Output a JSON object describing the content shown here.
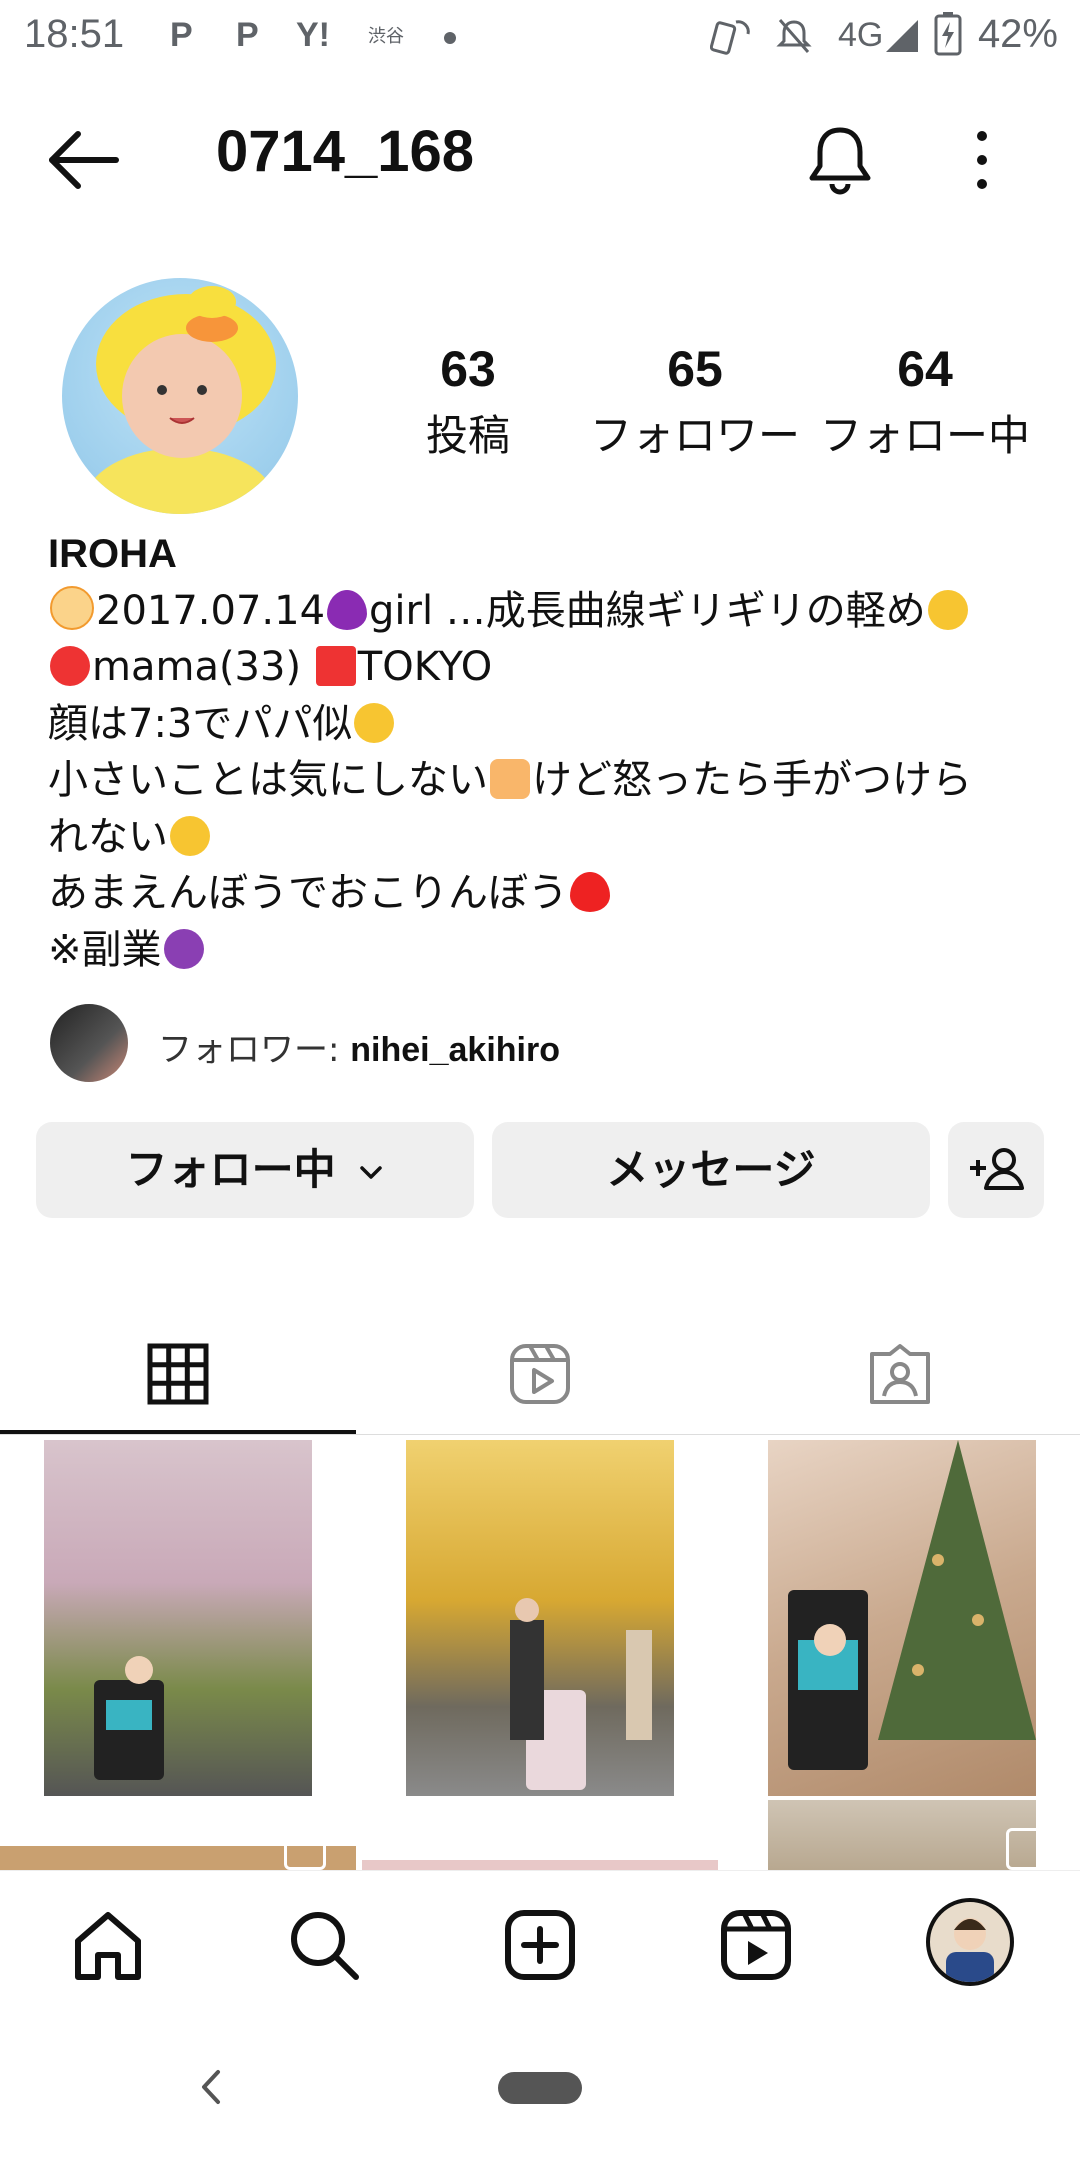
{
  "status_bar": {
    "time": "18:51",
    "notif_icons": [
      "P",
      "P",
      "Y!",
      "渋谷"
    ],
    "network": "4G",
    "battery": "42%"
  },
  "header": {
    "username": "0714_168"
  },
  "stats": [
    {
      "value": "63",
      "label": "投稿"
    },
    {
      "value": "65",
      "label": "フォロワー"
    },
    {
      "value": "64",
      "label": "フォロー中"
    }
  ],
  "bio": {
    "name": "IROHA",
    "line1_a": "2017.07.14",
    "line1_b": "girl …成長曲線ギリギリの軽め",
    "line2_a": "mama(33)",
    "line2_b": "TOKYO",
    "line3": "顔は7:3でパパ似",
    "line4_a": "小さいことは気にしない",
    "line4_b": "けど怒ったら手がつけら",
    "line5": "れない",
    "line6": "あまえんぼうでおこりんぼう",
    "line7": "※副業"
  },
  "followed_by": {
    "label": "フォロワー: ",
    "user": "nihei_akihiro"
  },
  "buttons": {
    "follow_label": "フォロー中",
    "message_label": "メッセージ"
  },
  "icons": [
    "back-arrow-icon",
    "bell-icon",
    "more-vert-icon",
    "add-user-icon",
    "grid-icon",
    "reels-icon",
    "tagged-icon",
    "home-icon",
    "search-icon",
    "create-icon",
    "reels-nav-icon"
  ],
  "colors": {
    "button_bg": "#efefef",
    "text": "#111111"
  }
}
